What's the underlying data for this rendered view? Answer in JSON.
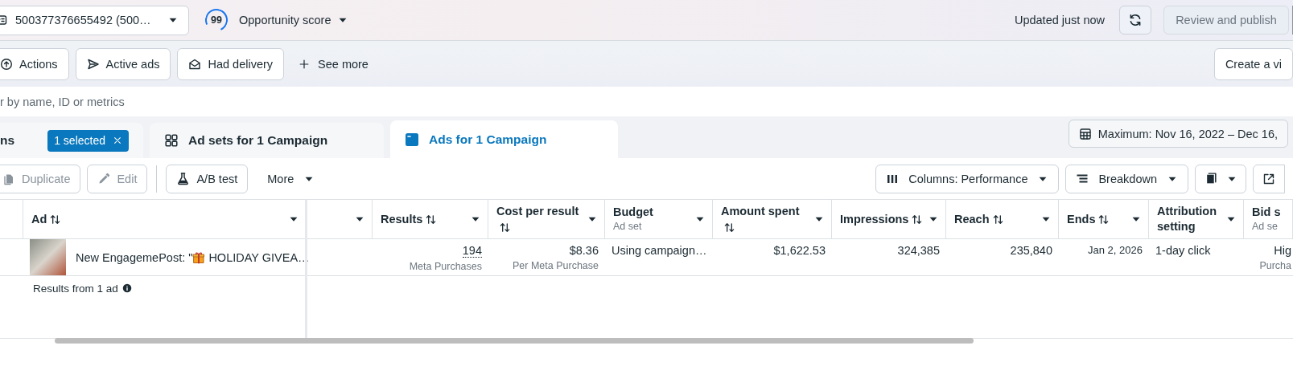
{
  "top_bar": {
    "account_selector": {
      "value": "500377376655492 (500…"
    },
    "opportunity_score": {
      "score": "99",
      "label": "Opportunity score"
    },
    "status": "Updated just now",
    "publish_button": {
      "label": "Review and publish",
      "disabled": true
    }
  },
  "filters": [
    {
      "label": "Actions"
    },
    {
      "label": "Active ads"
    },
    {
      "label": "Had delivery"
    }
  ],
  "see_more": "See more",
  "create_view": "Create a vi",
  "search": {
    "placeholder": "r by name, ID or metrics"
  },
  "tabs": [
    {
      "label": "ns",
      "selected": false,
      "badge": "1 selected"
    },
    {
      "label": "Ad sets for 1 Campaign",
      "selected": false
    },
    {
      "label": "Ads for 1 Campaign",
      "selected": true
    }
  ],
  "date_range": "Maximum: Nov 16, 2022 – Dec 16,",
  "toolbar": {
    "left": [
      {
        "label": "Duplicate",
        "disabled": true
      },
      {
        "label": "Edit",
        "disabled": true
      },
      {
        "label": "A/B test",
        "disabled": false
      }
    ],
    "more": "More",
    "right": [
      {
        "label": "Columns: Performance"
      },
      {
        "label": "Breakdown"
      }
    ]
  },
  "table": {
    "columns": [
      {
        "label": "Ad",
        "sortable": true,
        "menu": true
      },
      {
        "menu": true
      },
      {
        "label": "Results",
        "sortable": true,
        "menu": true
      },
      {
        "label": "Cost per result",
        "sortable": true,
        "menu": true
      },
      {
        "label": "Budget",
        "sub": "Ad set",
        "sortable": false,
        "menu": true
      },
      {
        "label": "Amount spent",
        "sortable": true,
        "menu": true
      },
      {
        "label": "Impressions",
        "sortable": true,
        "menu": true
      },
      {
        "label": "Reach",
        "sortable": true,
        "menu": true
      },
      {
        "label": "Ends",
        "sortable": true,
        "menu": true
      },
      {
        "label": "Attribution setting",
        "sortable": false,
        "menu": true
      },
      {
        "label": "Bid s",
        "sub": "Ad se",
        "sortable": false,
        "menu": false
      }
    ],
    "rows": [
      {
        "cells": [
          {
            "kind": "ad",
            "prefix": "New EngagemePost: \"",
            "title": "HOLIDAY GIVEA…"
          },
          null,
          {
            "kind": "metric",
            "value": "194",
            "sub": "Meta Purchases",
            "link": true
          },
          {
            "kind": "metric",
            "value": "$8.36",
            "sub": "Per Meta Purchase",
            "link": false
          },
          {
            "kind": "text",
            "value": "Using campaign…"
          },
          {
            "kind": "metric",
            "value": "$1,622.53",
            "link": false
          },
          {
            "kind": "metric",
            "value": "324,385",
            "link": false
          },
          {
            "kind": "metric",
            "value": "235,840",
            "link": false
          },
          {
            "kind": "date",
            "value": "Jan 2, 2026"
          },
          {
            "kind": "text",
            "value": "1-day click"
          },
          {
            "kind": "metric",
            "value": "Hig",
            "sub": "Purcha",
            "link": false
          }
        ]
      }
    ],
    "summary": {
      "label": "Results from 1 ad"
    }
  }
}
